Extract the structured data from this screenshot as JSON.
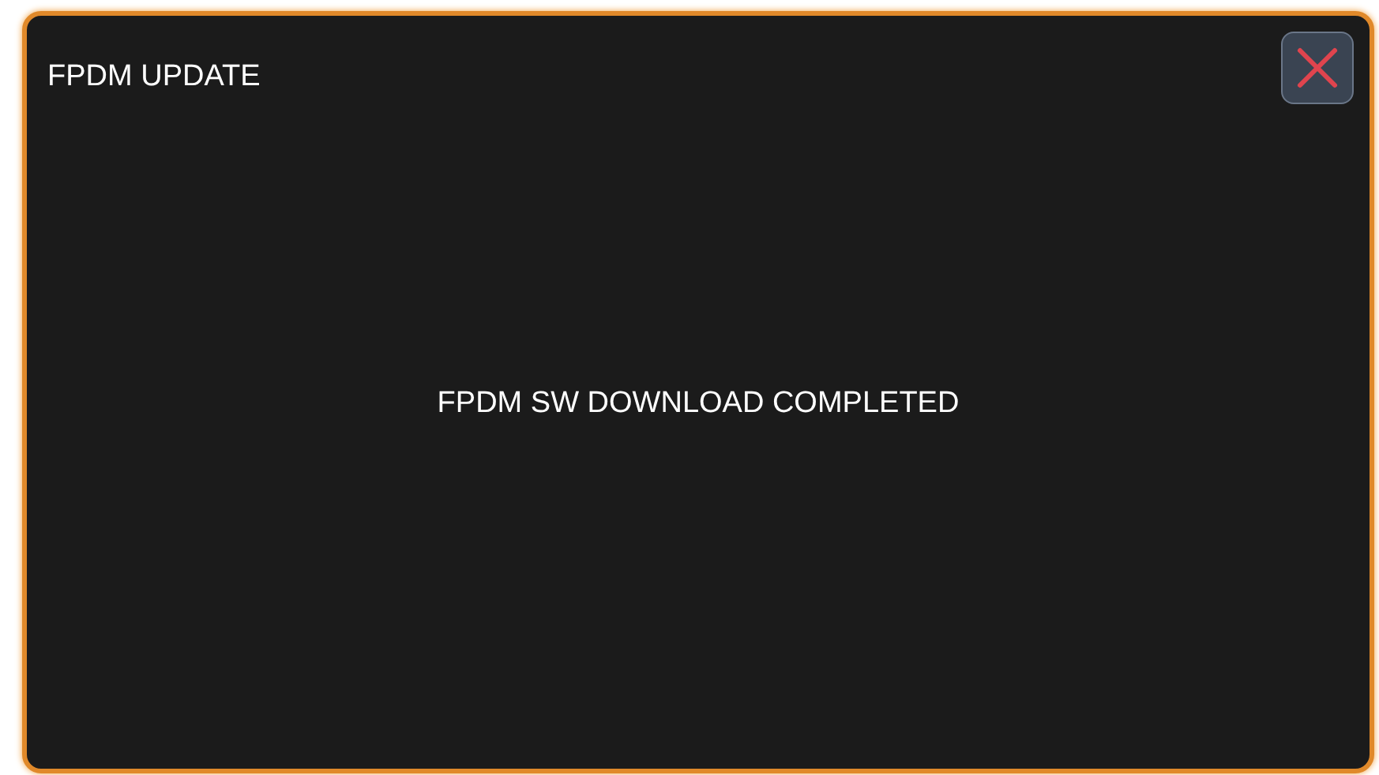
{
  "dialog": {
    "title": "FPDM UPDATE",
    "message": "FPDM SW DOWNLOAD COMPLETED"
  }
}
